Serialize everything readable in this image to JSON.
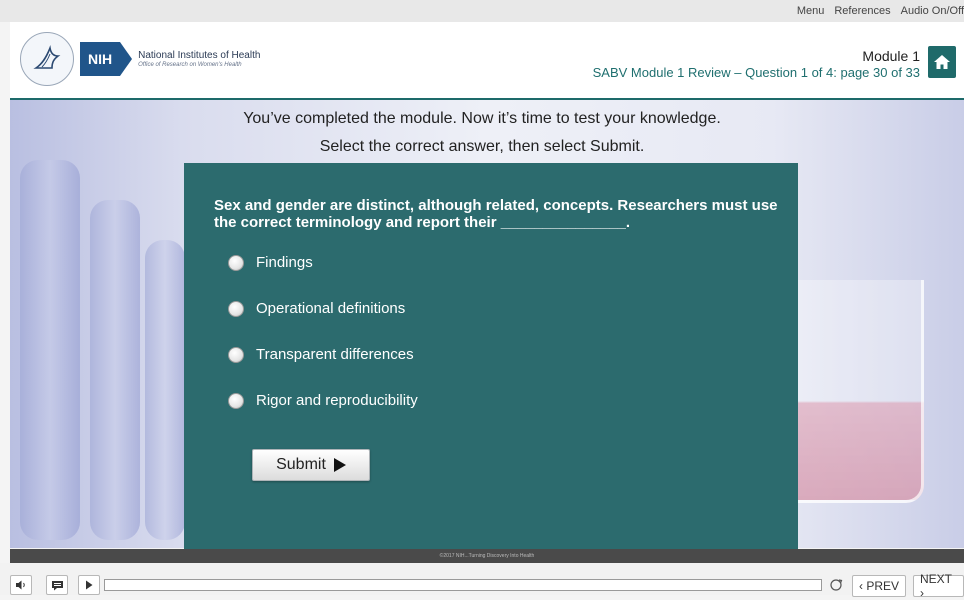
{
  "top_menu": {
    "menu": "Menu",
    "references": "References",
    "audio": "Audio On/Off"
  },
  "header": {
    "org_abbrev": "NIH",
    "org_name": "National Institutes of Health",
    "org_office": "Office of Research on Women's Health",
    "module_title": "Module 1",
    "module_subtitle": "SABV Module 1 Review – Question 1 of 4: page 30 of 33",
    "accent_color": "#1f6a6a"
  },
  "intro": {
    "line1": "You’ve completed the module. Now it’s time to test your knowledge.",
    "line2": "Select the correct answer, then select Submit."
  },
  "quiz": {
    "question": "Sex and gender are distinct, although related, concepts. Researchers must use the correct terminology and report their _______________.",
    "options": [
      "Findings",
      "Operational definitions",
      "Transparent differences",
      "Rigor and reproducibility"
    ],
    "submit_label": "Submit",
    "panel_color": "#2c6b6e"
  },
  "footer": {
    "copyright": "©2017 NIH...Turning Discovery Into Health"
  },
  "controls": {
    "prev_label": "‹ PREV",
    "next_label": "NEXT ›"
  }
}
